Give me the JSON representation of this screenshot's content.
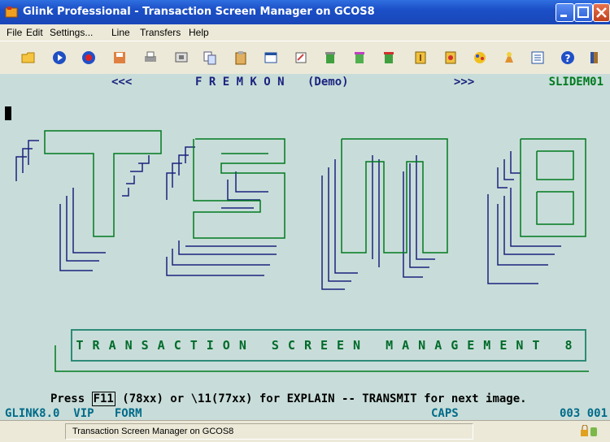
{
  "window": {
    "title": "Glink Professional - Transaction Screen Manager on GCOS8"
  },
  "menu": [
    "File",
    "Edit",
    "Settings...",
    "Line",
    "Transfers",
    "Help"
  ],
  "toolbar_icons": [
    "open-folder-icon",
    "play-icon",
    "record-icon",
    "save-icon",
    "print-icon",
    "screen-icon",
    "copy-icon",
    "paste-icon",
    "window-icon",
    "macro-icon",
    "transfer-icon",
    "key-icon",
    "stop-icon",
    "settings-icon",
    "config-icon",
    "color-icon",
    "connect-icon",
    "list-icon",
    "help-icon",
    "exit-icon"
  ],
  "terminal": {
    "nav_prev": "<<<",
    "header": "F R E M K O N",
    "header_note": "(Demo)",
    "nav_next": ">>>",
    "slide_id": "SLIDEM01",
    "logo_text": "TSM8",
    "banner": "TRANSACTION SCREEN MANAGEMENT 8",
    "press_prefix": "Press ",
    "press_key": "F11",
    "press_suffix": " (78xx) or \\11(77xx) for EXPLAIN -- TRANSMIT for next image.",
    "status_left": "GLINK8.0  VIP   FORM",
    "status_caps": "CAPS",
    "status_pos": "003 001"
  },
  "statusbar": {
    "text": "Transaction Screen Manager on GCOS8"
  },
  "colors": {
    "terminal_bg": "#c8ddd9",
    "logo_green": "#007a1f",
    "logo_navy": "#1a237e"
  }
}
